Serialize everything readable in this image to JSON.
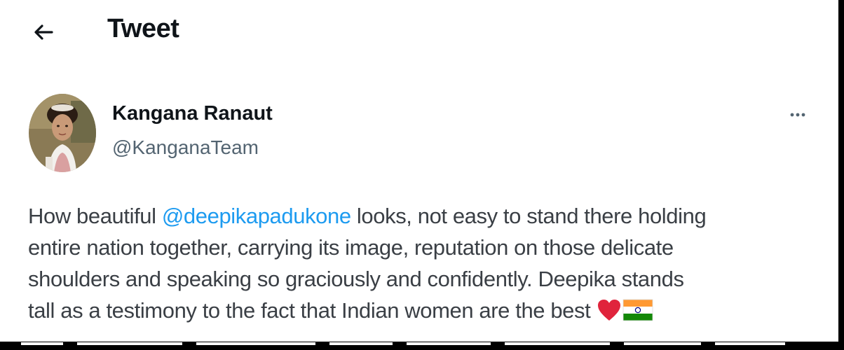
{
  "header": {
    "back_icon": "arrow-left-icon",
    "title": "Tweet"
  },
  "author": {
    "avatar_icon": "profile-photo",
    "display_name": "Kangana Ranaut",
    "handle": "@KanganaTeam",
    "more_icon": "more-horizontal-icon"
  },
  "tweet": {
    "line1_prefix": "How beautiful ",
    "mention": "@deepikapadukone",
    "line1_suffix": " looks, not easy to stand there holding",
    "line2": "entire nation together, carrying its image, reputation on those delicate",
    "line3": "shoulders and speaking so graciously and confidently. Deepika stands",
    "line4": "tall as a testimony to the fact that Indian women are the best ",
    "emojis": [
      "red-heart-emoji",
      "india-flag-emoji"
    ]
  },
  "colors": {
    "text_primary": "#0f1419",
    "text_secondary": "#536471",
    "link": "#1d9bf0",
    "heart": "#e0243c",
    "flag_saffron": "#ff9933",
    "flag_green": "#138808",
    "chakra": "#000080"
  }
}
